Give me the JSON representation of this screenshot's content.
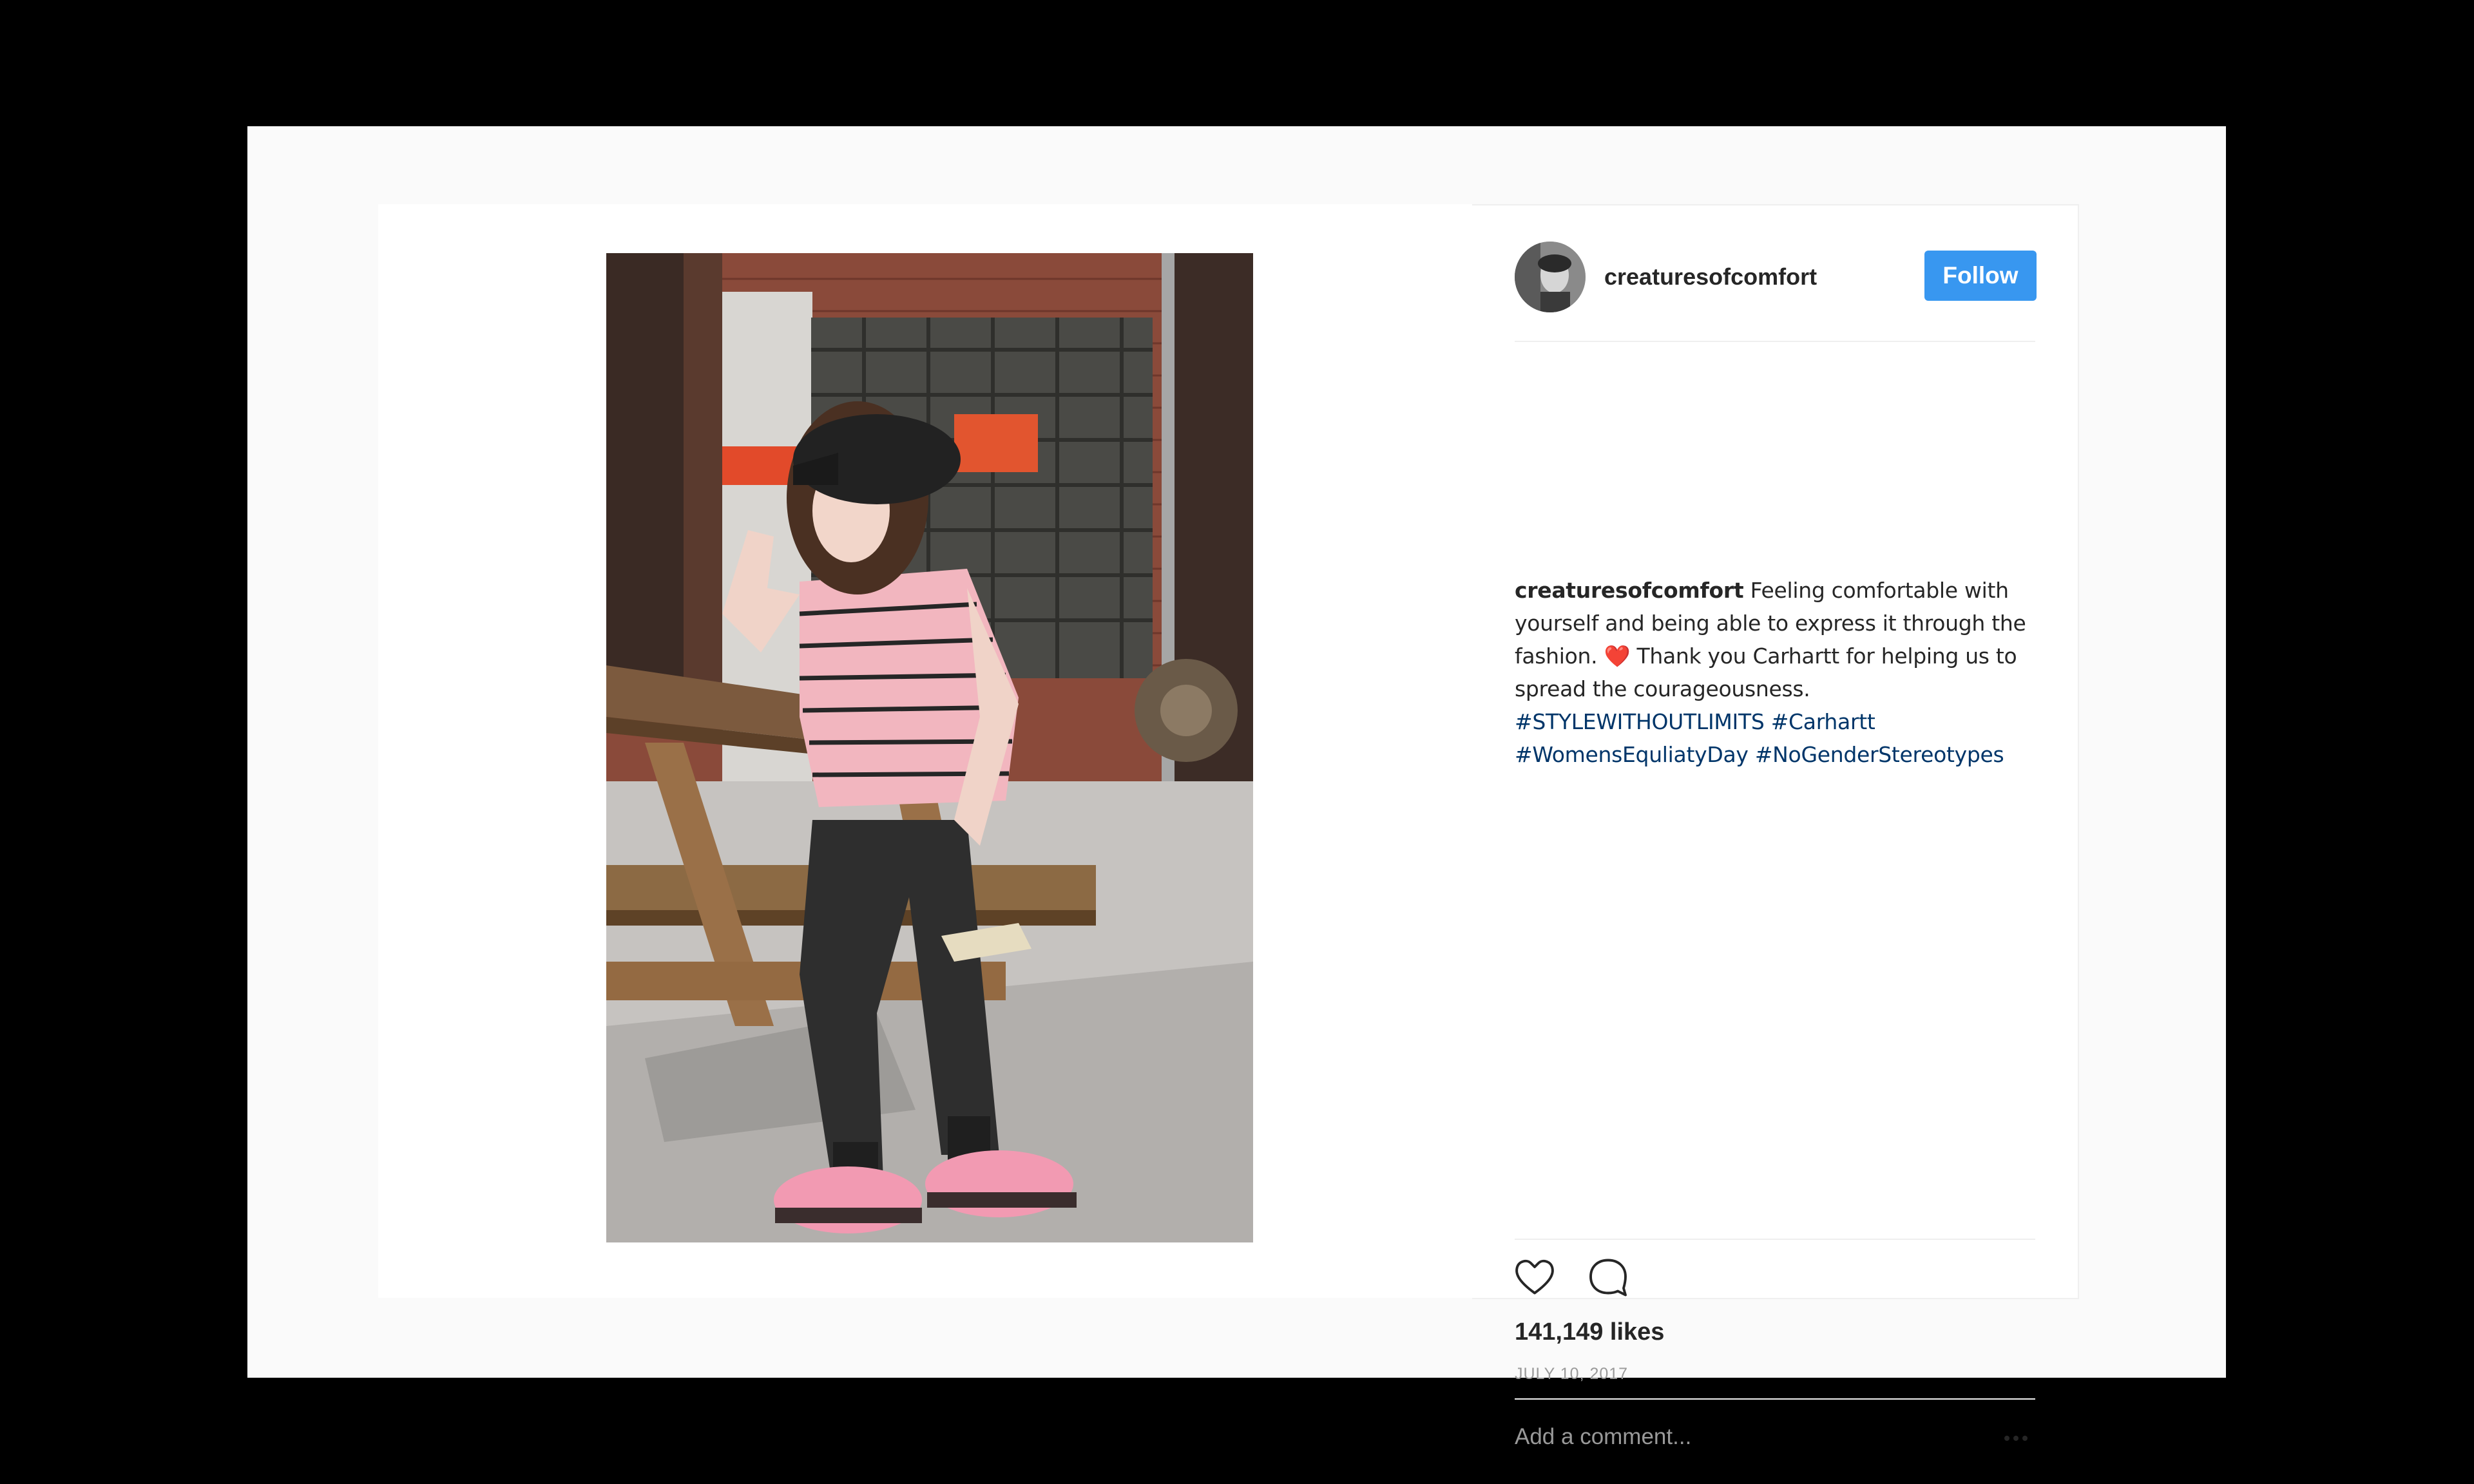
{
  "post": {
    "username": "creaturesofcomfort",
    "follow_label": "Follow",
    "caption": {
      "username": "creaturesofcomfort",
      "text_1": "Feeling comfortable with yourself and being able to express it through the fashion.",
      "emoji": "❤️",
      "text_2": "Thank you Carhartt for helping us to spread the courageousness.",
      "hashtags": [
        "#STYLEWITHOUTLIMITS",
        "#Carhartt",
        "#WomensEquliatyDay",
        "#NoGenderStereotypes"
      ]
    },
    "likes": "141,149 likes",
    "date": "JULY 10, 2017",
    "comment_placeholder": "Add a comment..."
  },
  "icons": {
    "like": "heart-icon",
    "comment": "comment-icon",
    "more": "more-options-icon"
  },
  "colors": {
    "follow_button": "#3897f0",
    "hashtag": "#003569",
    "text": "#262626",
    "muted": "#999999"
  }
}
